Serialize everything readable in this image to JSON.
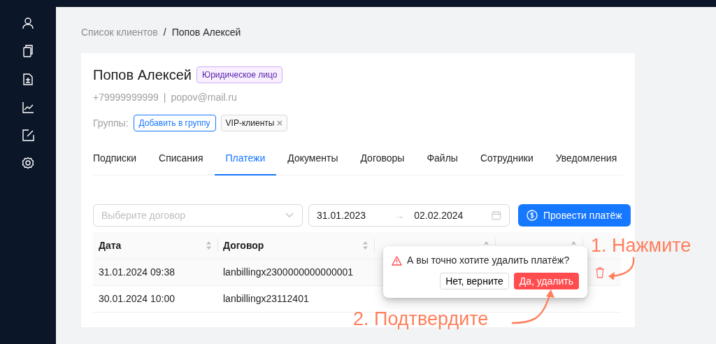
{
  "breadcrumb": {
    "separator": "/",
    "items": [
      "Список клиентов",
      "Попов Алексей"
    ]
  },
  "client": {
    "name": "Попов Алексей",
    "type_badge": "Юридическое лицо",
    "phone": "+79999999999",
    "divider": "|",
    "email": "popov@mail.ru",
    "groups_label": "Группы:",
    "add_group_button": "Добавить в группу",
    "groups": [
      {
        "label": "VIP-клиенты"
      }
    ]
  },
  "tabs": [
    {
      "label": "Подписки",
      "selected": false
    },
    {
      "label": "Списания",
      "selected": false
    },
    {
      "label": "Платежи",
      "selected": true
    },
    {
      "label": "Документы",
      "selected": false
    },
    {
      "label": "Договоры",
      "selected": false
    },
    {
      "label": "Файлы",
      "selected": false
    },
    {
      "label": "Сотрудники",
      "selected": false
    },
    {
      "label": "Уведомления",
      "selected": false
    }
  ],
  "filters": {
    "contract": {
      "placeholder": "Выберите договор"
    },
    "date_from": "31.01.2023",
    "arrow": "→",
    "date_to": "02.02.2024",
    "submit_button": "Провести платёж"
  },
  "table": {
    "columns": [
      "Дата",
      "Договор"
    ],
    "rows": [
      {
        "date": "31.01.2024 09:38",
        "contract": "lanbillingx2300000000000001",
        "hovered": true
      },
      {
        "date": "30.01.2024 10:00",
        "contract": "lanbillingx23112401",
        "hovered": false
      }
    ]
  },
  "popover": {
    "message": "А вы точно хотите удалить платёж?",
    "cancel_button": "Нет, верните",
    "confirm_button": "Да, удалить"
  },
  "annotations": [
    {
      "text": "1. Нажмите"
    },
    {
      "text": "2. Подтвердите"
    }
  ]
}
